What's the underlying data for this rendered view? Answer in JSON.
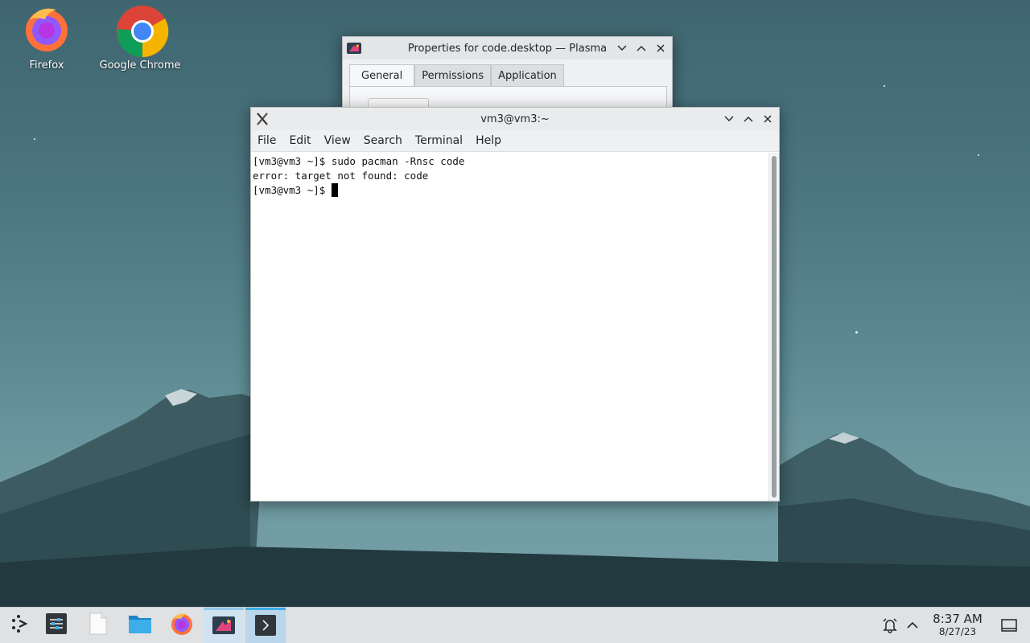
{
  "desktop": {
    "icons": [
      {
        "label": "Firefox",
        "icon": "firefox-icon"
      },
      {
        "label": "Google Chrome",
        "icon": "chrome-icon"
      }
    ]
  },
  "properties_dialog": {
    "title": "Properties for code.desktop — Plasma",
    "tabs": [
      "General",
      "Permissions",
      "Application"
    ],
    "active_tab": "General"
  },
  "terminal": {
    "title": "vm3@vm3:~",
    "menu": [
      "File",
      "Edit",
      "View",
      "Search",
      "Terminal",
      "Help"
    ],
    "lines": [
      "[vm3@vm3 ~]$ sudo pacman -Rnsc code",
      "error: target not found: code",
      "[vm3@vm3 ~]$ "
    ]
  },
  "taskbar": {
    "items": [
      "application-launcher-icon",
      "system-settings-icon",
      "text-editor-icon",
      "file-manager-icon",
      "firefox-icon",
      "properties-dialog-icon",
      "terminal-icon"
    ],
    "clock": {
      "time": "8:37 AM",
      "date": "8/27/23"
    },
    "tray": [
      "notifications-icon",
      "tray-expand-icon",
      "show-desktop-icon"
    ]
  },
  "colors": {
    "accent": "#3daee9",
    "active_task": "#b9d6ea"
  }
}
